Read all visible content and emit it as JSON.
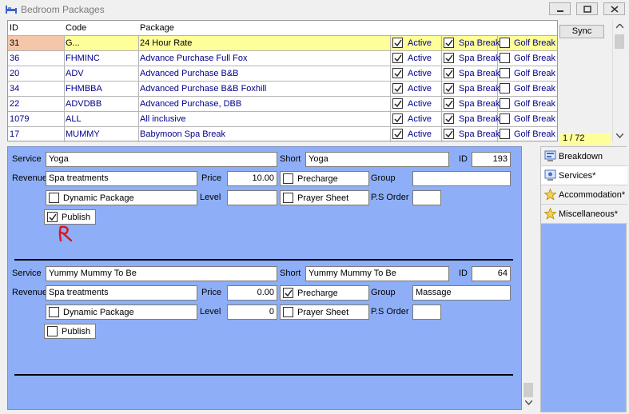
{
  "window": {
    "title": "Bedroom Packages"
  },
  "grid": {
    "headers": {
      "id": "ID",
      "code": "Code",
      "package": "Package"
    },
    "flag_labels": {
      "active": "Active",
      "spa": "Spa Break",
      "golf": "Golf Break"
    },
    "rows": [
      {
        "id": "31",
        "code": "G...",
        "package": "24 Hour Rate",
        "active": true,
        "spa": true,
        "golf": false
      },
      {
        "id": "36",
        "code": "FHMINC",
        "package": "Advance Purchase Full Fox",
        "active": true,
        "spa": true,
        "golf": false
      },
      {
        "id": "20",
        "code": "ADV",
        "package": "Advanced Purchase B&B",
        "active": true,
        "spa": true,
        "golf": false
      },
      {
        "id": "34",
        "code": "FHMBBA",
        "package": "Advanced Purchase B&B Foxhill",
        "active": true,
        "spa": true,
        "golf": false
      },
      {
        "id": "22",
        "code": "ADVDBB",
        "package": "Advanced Purchase, DBB",
        "active": true,
        "spa": true,
        "golf": false
      },
      {
        "id": "1079",
        "code": "ALL",
        "package": "All inclusive",
        "active": true,
        "spa": true,
        "golf": false
      },
      {
        "id": "17",
        "code": "MUMMY",
        "package": "Babymoon Spa Break",
        "active": true,
        "spa": true,
        "golf": false
      }
    ],
    "sync_label": "Sync",
    "counter": "1 / 72"
  },
  "labels": {
    "service": "Service",
    "short": "Short",
    "id": "ID",
    "revenue": "Revenue",
    "price": "Price",
    "precharge": "Precharge",
    "group": "Group",
    "dynamic": "Dynamic Package",
    "level": "Level",
    "prayer": "Prayer Sheet",
    "ps_order": "P.S Order",
    "publish": "Publish"
  },
  "services": [
    {
      "service": "Yoga",
      "short": "Yoga",
      "id": "193",
      "revenue": "Spa treatments",
      "price": "10.00",
      "precharge": false,
      "group": "",
      "dynamic": false,
      "level": "",
      "prayer": false,
      "ps_order": "",
      "publish": true
    },
    {
      "service": "Yummy Mummy To Be",
      "short": "Yummy Mummy To Be",
      "id": "64",
      "revenue": "Spa treatments",
      "price": "0.00",
      "precharge": true,
      "group": "Massage",
      "dynamic": false,
      "level": "0",
      "prayer": false,
      "ps_order": "",
      "publish": false
    }
  ],
  "tabs": [
    {
      "label": "Breakdown",
      "icon": "breakdown-icon",
      "active": false
    },
    {
      "label": "Services*",
      "icon": "services-icon",
      "active": true
    },
    {
      "label": "Accommodation*",
      "icon": "star-icon",
      "active": false
    },
    {
      "label": "Miscellaneous*",
      "icon": "star-icon",
      "active": false
    }
  ],
  "colors": {
    "panel": "#8eaff7",
    "selected_row": "#ffff9a",
    "link_text": "#00008b",
    "annotation": "#e0161b"
  }
}
